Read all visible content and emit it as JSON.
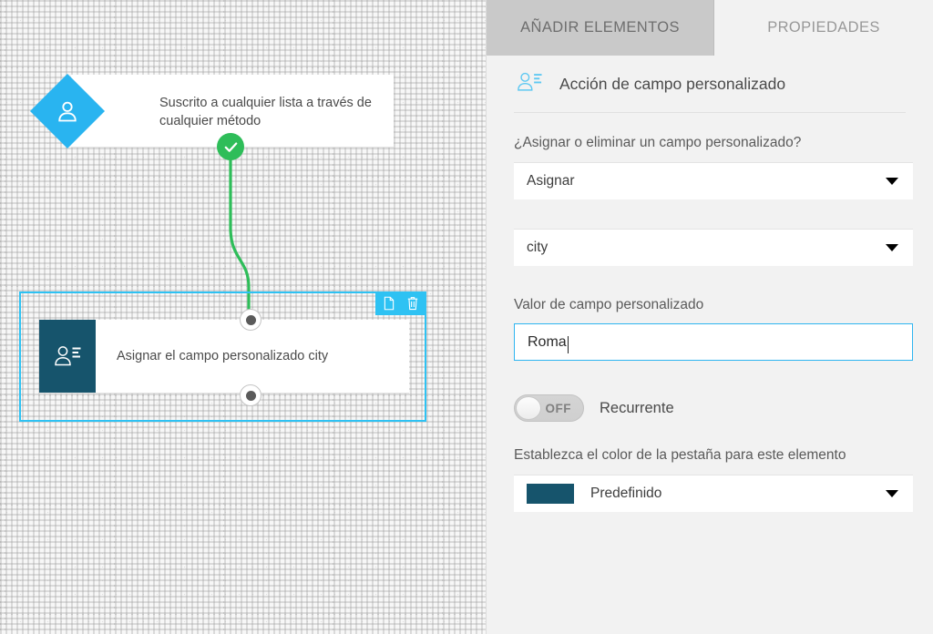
{
  "panel": {
    "tabs": [
      {
        "label": "AÑADIR ELEMENTOS",
        "active": true
      },
      {
        "label": "PROPIEDADES",
        "active": false
      }
    ],
    "section": {
      "icon": "custom-field-icon",
      "title": "Acción de campo personalizado"
    },
    "fields": {
      "action_label": "¿Asignar o eliminar un campo personalizado?",
      "action_value": "Asignar",
      "field_value": "city",
      "value_label": "Valor de campo personalizado",
      "value_text": "Roma",
      "recurrent_toggle_state": "OFF",
      "recurrent_label": "Recurrente",
      "color_label": "Establezca el color de la pestaña para este elemento",
      "color_value": "Predefinido",
      "color_swatch_hex": "#16546c"
    }
  },
  "canvas": {
    "trigger_node": {
      "icon": "person-icon",
      "label": "Suscrito a cualquier lista a través de cualquier método",
      "diamond_hex": "#29b4f0",
      "status": "check-circle-icon",
      "status_hex": "#2ebd59"
    },
    "action_node": {
      "icon": "custom-field-icon",
      "label": "Asignar el campo personalizado city",
      "icon_box_hex": "#16546c",
      "selection_hex": "#2ec2f3",
      "toolbar": [
        {
          "name": "duplicate-icon",
          "title": "Duplicar"
        },
        {
          "name": "delete-icon",
          "title": "Eliminar"
        }
      ]
    },
    "connector_hex": "#2ebd59"
  }
}
